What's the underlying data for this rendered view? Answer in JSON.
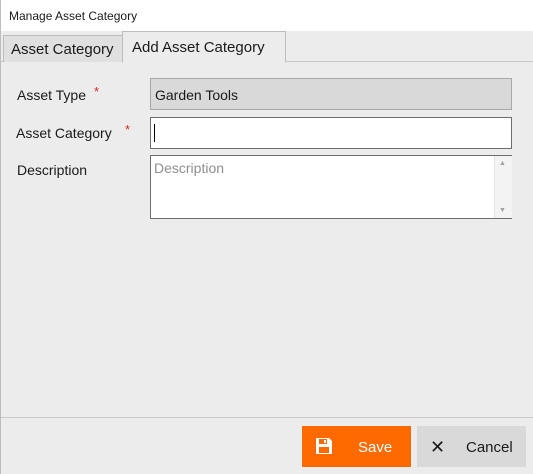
{
  "window": {
    "title": "Manage Asset Category"
  },
  "tabs": [
    {
      "label": "Asset Category",
      "active": false
    },
    {
      "label": "Add Asset Category",
      "active": true
    }
  ],
  "form": {
    "asset_type": {
      "label": "Asset Type",
      "required_mark": "*",
      "value": "Garden Tools"
    },
    "asset_category": {
      "label": "Asset Category",
      "required_mark": "*",
      "value": ""
    },
    "description": {
      "label": "Description",
      "placeholder": "Description",
      "value": ""
    }
  },
  "buttons": {
    "save": {
      "label": "Save",
      "icon": "save-icon",
      "color": "#ff6a00"
    },
    "cancel": {
      "label": "Cancel",
      "icon": "close-icon"
    }
  },
  "colors": {
    "accent": "#ff6a00",
    "required": "#d9262a"
  }
}
